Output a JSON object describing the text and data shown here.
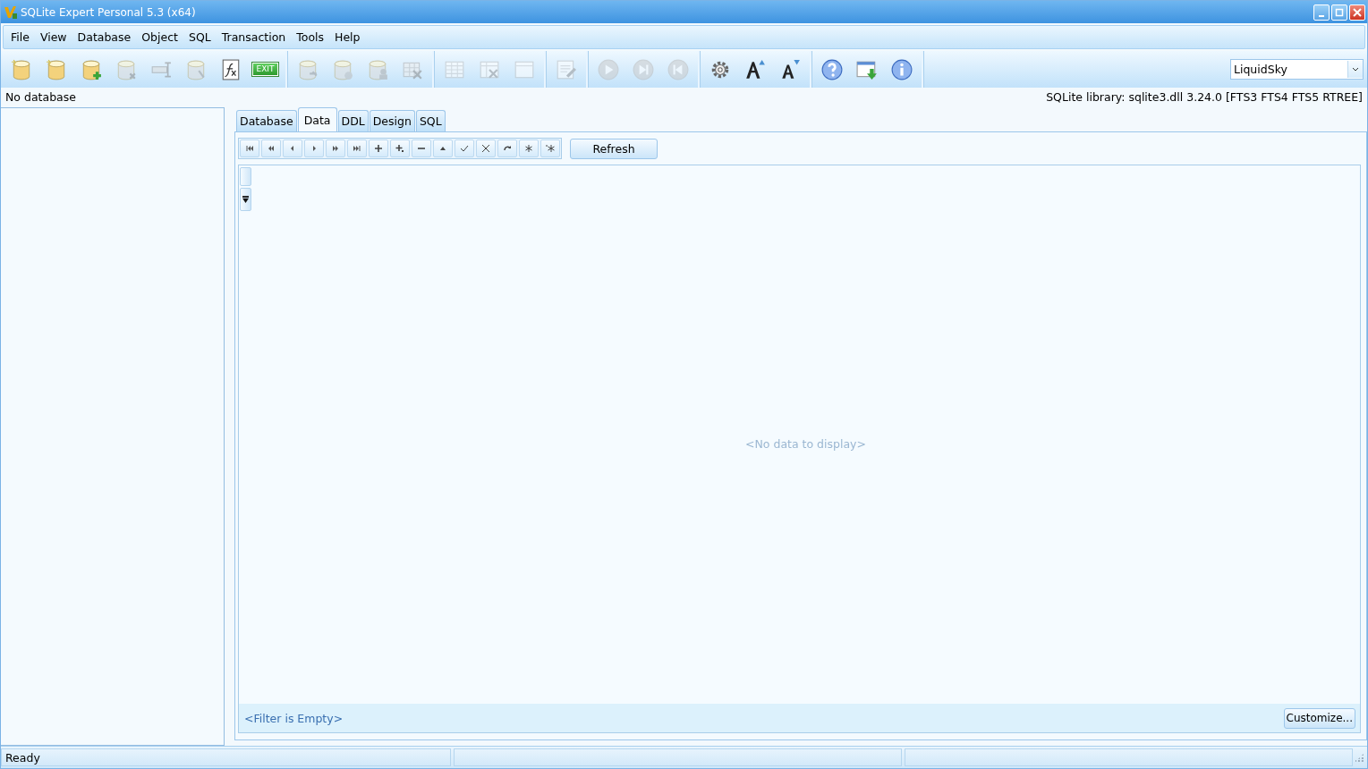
{
  "window": {
    "title": "SQLite Expert Personal 5.3 (x64)"
  },
  "menu": [
    "File",
    "View",
    "Database",
    "Object",
    "SQL",
    "Transaction",
    "Tools",
    "Help"
  ],
  "toolbar_groups": [
    [
      {
        "disabled": false
      },
      {
        "disabled": false
      },
      {
        "disabled": false
      },
      {
        "disabled": true
      },
      {
        "disabled": true
      },
      {
        "disabled": true
      },
      {
        "disabled": false
      },
      {
        "disabled": false,
        "label": "EXIT"
      }
    ],
    [
      {
        "disabled": true
      },
      {
        "disabled": true
      },
      {
        "disabled": true
      },
      {
        "disabled": true
      }
    ],
    [
      {
        "disabled": true
      },
      {
        "disabled": true
      },
      {
        "disabled": true
      }
    ],
    [
      {
        "disabled": true
      }
    ],
    [
      {
        "disabled": true
      },
      {
        "disabled": true
      },
      {
        "disabled": true
      }
    ],
    [
      {
        "disabled": false
      },
      {
        "disabled": false
      },
      {
        "disabled": false
      }
    ],
    [
      {
        "disabled": false
      },
      {
        "disabled": false
      },
      {
        "disabled": false
      }
    ]
  ],
  "skin_select": {
    "value": "LiquidSky"
  },
  "info_bar": {
    "database": "No database",
    "library": "SQLite library: sqlite3.dll 3.24.0 [FTS3 FTS4 FTS5 RTREE]"
  },
  "tabs": [
    {
      "label": "Database",
      "selected": false
    },
    {
      "label": "Data",
      "selected": true
    },
    {
      "label": "DDL",
      "selected": false
    },
    {
      "label": "Design",
      "selected": false
    },
    {
      "label": "SQL",
      "selected": false
    }
  ],
  "refresh_button": "Refresh",
  "grid": {
    "empty_text": "<No data to display>",
    "filter_text": "<Filter is Empty>",
    "customize_button": "Customize..."
  },
  "status_bar": {
    "text": "Ready"
  }
}
